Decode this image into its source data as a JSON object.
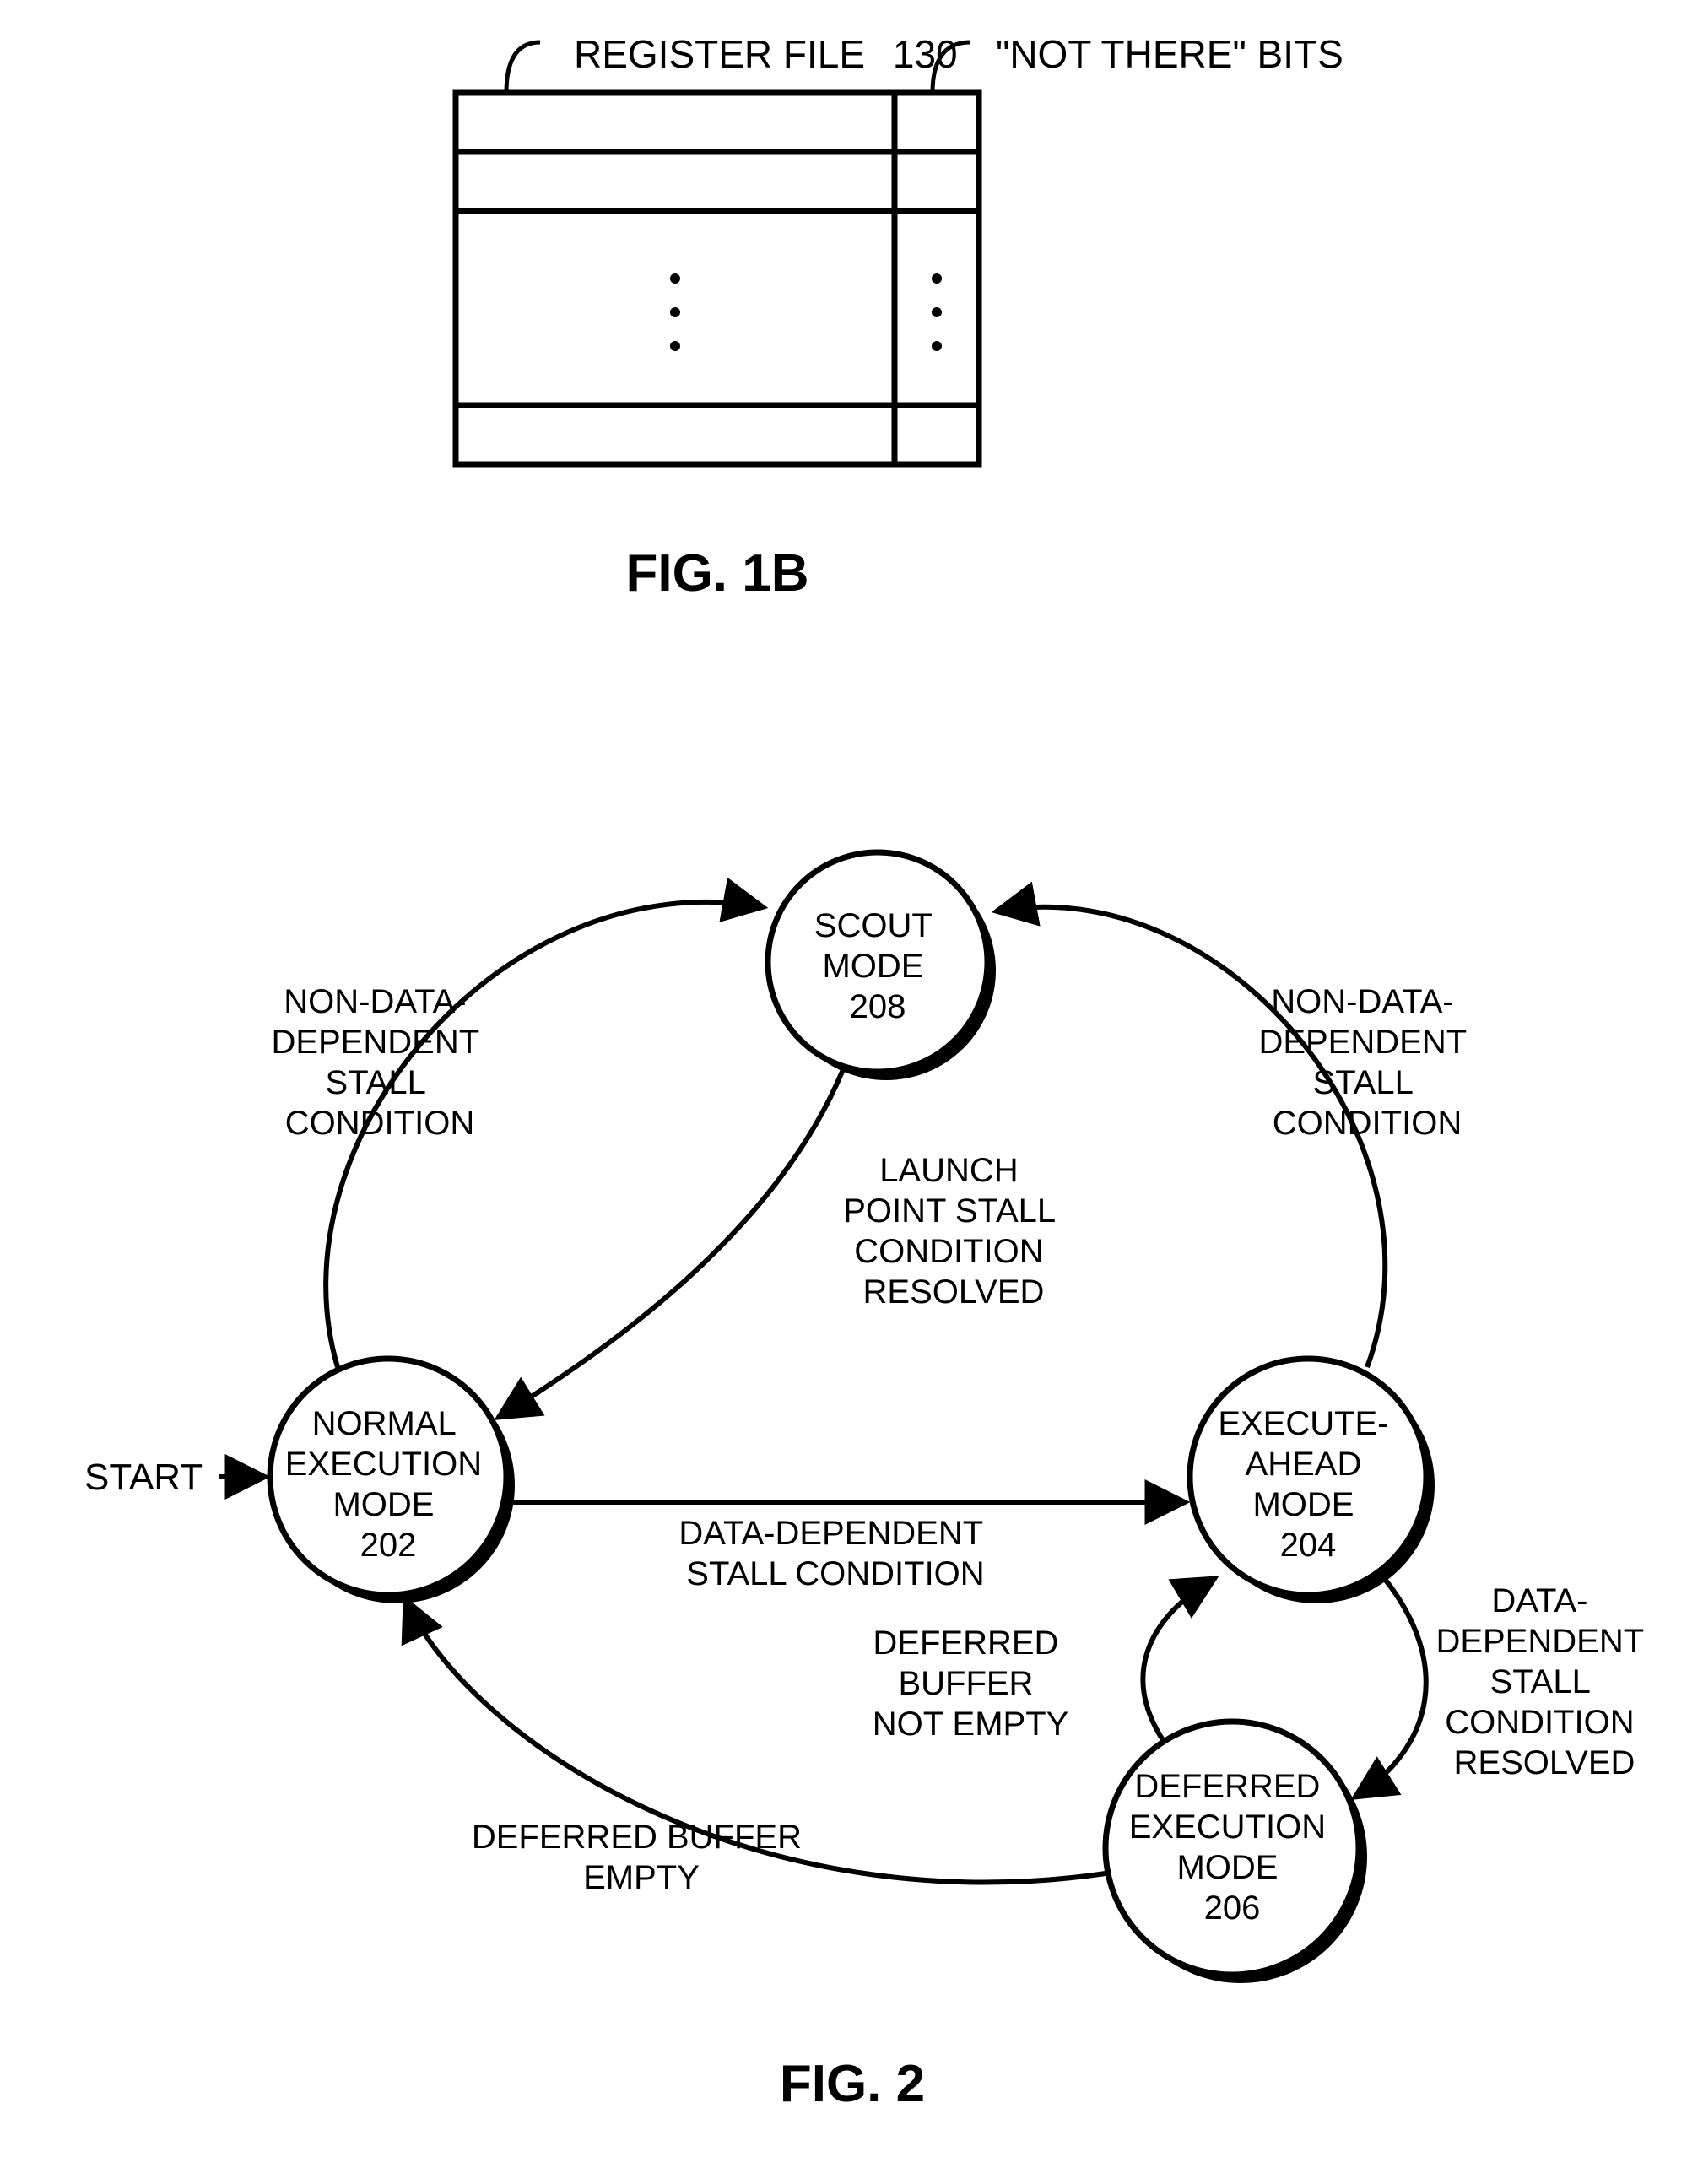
{
  "fig1b": {
    "caption": "FIG. 1B",
    "label_left": "REGISTER FILE",
    "label_left_num": "130",
    "label_right": "\"NOT THERE\" BITS"
  },
  "fig2": {
    "caption": "FIG. 2",
    "start": "START",
    "nodes": {
      "normal": {
        "l1": "NORMAL",
        "l2": "EXECUTION",
        "l3": "MODE",
        "num": "202"
      },
      "scout": {
        "l1": "SCOUT",
        "l2": "MODE",
        "num": "208"
      },
      "exec": {
        "l1": "EXECUTE-",
        "l2": "AHEAD",
        "l3": "MODE",
        "num": "204"
      },
      "defer": {
        "l1": "DEFERRED",
        "l2": "EXECUTION",
        "l3": "MODE",
        "num": "206"
      }
    },
    "edges": {
      "normal_to_scout": {
        "l1": "NON-DATA-",
        "l2": "DEPENDENT",
        "l3": "STALL",
        "l4": "CONDITION"
      },
      "exec_to_scout": {
        "l1": "NON-DATA-",
        "l2": "DEPENDENT",
        "l3": "STALL",
        "l4": "CONDITION"
      },
      "scout_to_normal": {
        "l1": "LAUNCH",
        "l2": "POINT STALL",
        "l3": "CONDITION",
        "l4": "RESOLVED"
      },
      "normal_to_exec": {
        "l1": "DATA-DEPENDENT",
        "l2": "STALL CONDITION"
      },
      "exec_to_defer": {
        "l1": "DATA-",
        "l2": "DEPENDENT",
        "l3": "STALL",
        "l4": "CONDITION",
        "l5": "RESOLVED"
      },
      "defer_to_exec": {
        "l1": "DEFERRED",
        "l2": "BUFFER",
        "l3": "NOT EMPTY"
      },
      "defer_to_normal": {
        "l1": "DEFERRED BUFFER",
        "l2": "EMPTY"
      }
    }
  }
}
